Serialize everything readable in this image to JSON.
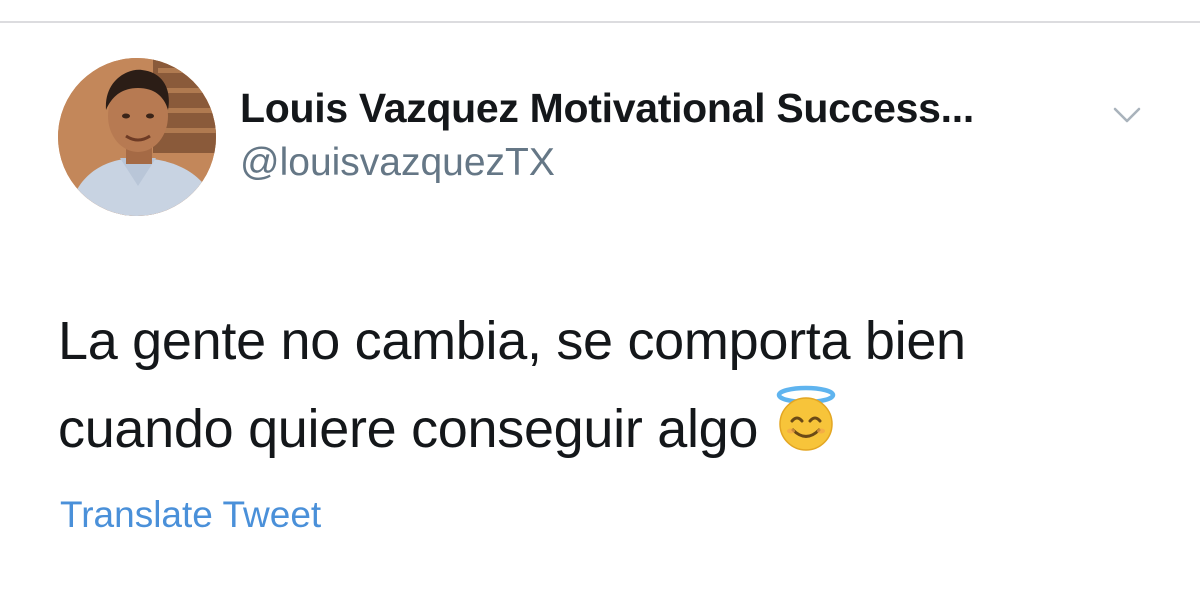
{
  "tweet": {
    "author": {
      "display_name": "Louis Vazquez Motivational Success...",
      "handle": "@louisvazquezTX",
      "avatar": "profile-photo"
    },
    "menu_icon": "chevron-down-icon",
    "text_lines": [
      "La gente no cambia, se comporta bien",
      "cuando quiere conseguir algo"
    ],
    "emoji": "smiling-face-with-halo",
    "translate_label": "Translate Tweet"
  },
  "colors": {
    "name_text": "#14171a",
    "handle_text": "#657786",
    "link": "#4a90d9",
    "divider": "#dcdcdf"
  }
}
